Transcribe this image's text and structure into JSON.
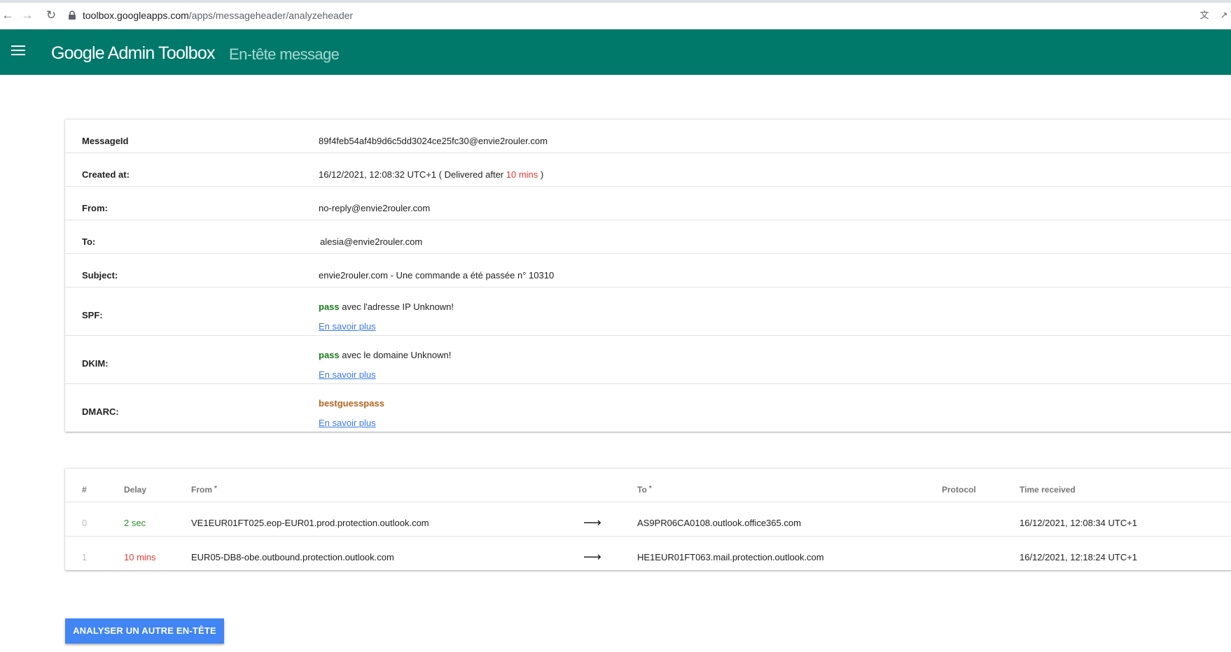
{
  "browser": {
    "url_host": "toolbox.googleapps.com",
    "url_path": "/apps/messageheader/analyzeheader"
  },
  "header": {
    "brand": "Google Admin Toolbox",
    "section": "En-tête message"
  },
  "details": {
    "messageid_label": "MessageId",
    "messageid_value": "89f4feb54af4b9d6c5dd3024ce25fc30@envie2rouler.com",
    "created_label": "Created at:",
    "created_value": "16/12/2021, 12:08:32 UTC+1 ( Delivered after ",
    "created_delay": "10 mins",
    "created_suffix": " )",
    "from_label": "From:",
    "from_value": "no-reply@envie2rouler.com",
    "to_label": "To:",
    "to_value": "alesia@envie2rouler.com",
    "subject_label": "Subject:",
    "subject_value": "envie2rouler.com - Une commande a été passée n° 10310",
    "spf_label": "SPF:",
    "spf_status": "pass",
    "spf_text": " avec l'adresse IP Unknown!",
    "dkim_label": "DKIM:",
    "dkim_status": "pass",
    "dkim_text": " avec le domaine Unknown!",
    "dmarc_label": "DMARC:",
    "dmarc_status": "bestguesspass",
    "learn_more": "En savoir plus"
  },
  "hops": {
    "headers": {
      "num": "#",
      "delay": "Delay",
      "from": "From",
      "to": "To",
      "protocol": "Protocol",
      "time": "Time received",
      "star": "*"
    },
    "rows": [
      {
        "num": "0",
        "delay": "2 sec",
        "from": "VE1EUR01FT025.eop-EUR01.prod.protection.outlook.com",
        "arrow": "⟶",
        "to": "AS9PR06CA0108.outlook.office365.com",
        "protocol": "",
        "time": "16/12/2021, 12:08:34 UTC+1"
      },
      {
        "num": "1",
        "delay": "10 mins",
        "from": "EUR05-DB8-obe.outbound.protection.outlook.com",
        "arrow": "⟶",
        "to": "HE1EUR01FT063.mail.protection.outlook.com",
        "protocol": "",
        "time": "16/12/2021, 12:18:24 UTC+1"
      }
    ]
  },
  "actions": {
    "analyze_button": "ANALYSER UN AUTRE EN-TÊTE"
  },
  "colors": {
    "header_bg": "#00796b",
    "button_bg": "#4285f4",
    "link": "#3b78e7",
    "pass_green": "#1a7a1a",
    "delay_red": "#e53935",
    "dmarc_orange": "#b5651d"
  }
}
